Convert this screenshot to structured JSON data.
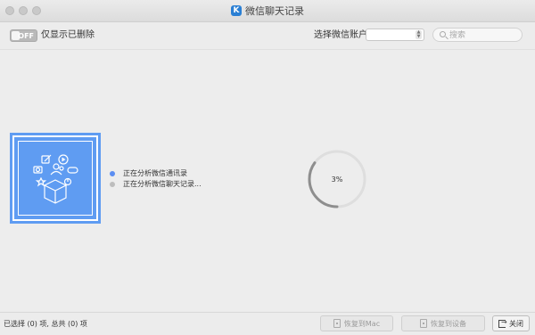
{
  "window": {
    "title": "微信聊天记录",
    "app_icon": "K"
  },
  "toolbar": {
    "toggle_text": "OFF",
    "show_deleted_label": "仅显示已删除",
    "account_label": "选择微信账户",
    "account_value": "",
    "search_placeholder": "搜索"
  },
  "main": {
    "status": [
      {
        "text": "正在分析微信通讯录",
        "color": "#5c8ef2"
      },
      {
        "text": "正在分析微信聊天记录...",
        "color": "#bdbdbd"
      }
    ],
    "progress_text": "3%",
    "progress": 0.03,
    "illustration_icons": [
      "edit-icon",
      "play-icon",
      "camera-icon",
      "contacts-icon",
      "gamepad-icon",
      "star-icon",
      "pie-icon",
      "box-icon"
    ]
  },
  "bottom": {
    "selection_text": "已选择 (0) 项, 总共 (0) 项",
    "restore_mac": "恢复到Mac",
    "restore_device": "恢复到设备",
    "close": "关闭"
  },
  "colors": {
    "accent": "#5f9cf2",
    "active_dot": "#5c8ef2",
    "inactive_dot": "#bdbdbd"
  }
}
